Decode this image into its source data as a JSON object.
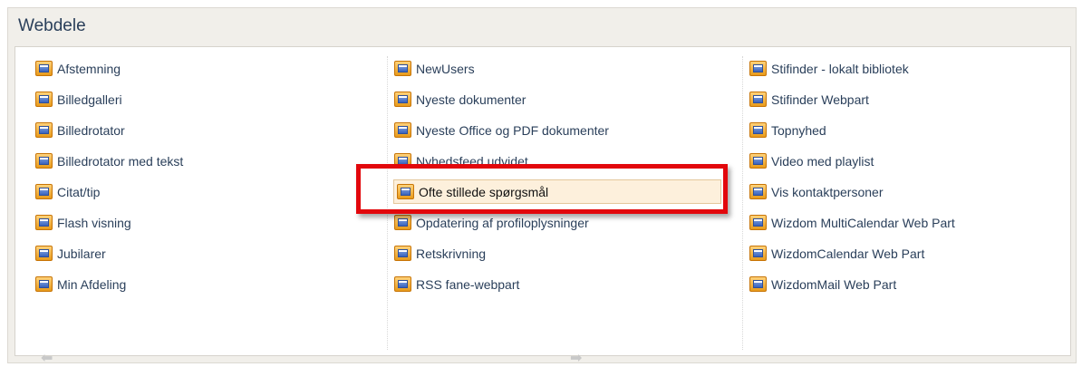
{
  "panel": {
    "title": "Webdele"
  },
  "columns": [
    {
      "items": [
        {
          "label": "Afstemning"
        },
        {
          "label": "Billedgalleri"
        },
        {
          "label": "Billedrotator"
        },
        {
          "label": "Billedrotator med tekst"
        },
        {
          "label": "Citat/tip"
        },
        {
          "label": "Flash visning"
        },
        {
          "label": "Jubilarer"
        },
        {
          "label": "Min Afdeling"
        }
      ]
    },
    {
      "items": [
        {
          "label": "NewUsers"
        },
        {
          "label": "Nyeste dokumenter"
        },
        {
          "label": "Nyeste Office og PDF dokumenter"
        },
        {
          "label": "Nyhedsfeed udvidet"
        },
        {
          "label": "Ofte stillede spørgsmål",
          "selected": true
        },
        {
          "label": "Opdatering af profiloplysninger"
        },
        {
          "label": "Retskrivning"
        },
        {
          "label": "RSS fane-webpart"
        }
      ]
    },
    {
      "items": [
        {
          "label": "Stifinder - lokalt bibliotek"
        },
        {
          "label": "Stifinder Webpart"
        },
        {
          "label": "Topnyhed"
        },
        {
          "label": "Video med playlist"
        },
        {
          "label": "Vis kontaktpersoner"
        },
        {
          "label": "Wizdom MultiCalendar Web Part"
        },
        {
          "label": "WizdomCalendar Web Part"
        },
        {
          "label": "WizdomMail Web Part"
        }
      ]
    }
  ],
  "pager": {
    "prev_icon": "arrow-left-icon",
    "next_icon": "arrow-right-icon"
  },
  "colors": {
    "highlight": "#e2070c",
    "text": "#2a3f5a",
    "panel_bg": "#f1efea"
  }
}
